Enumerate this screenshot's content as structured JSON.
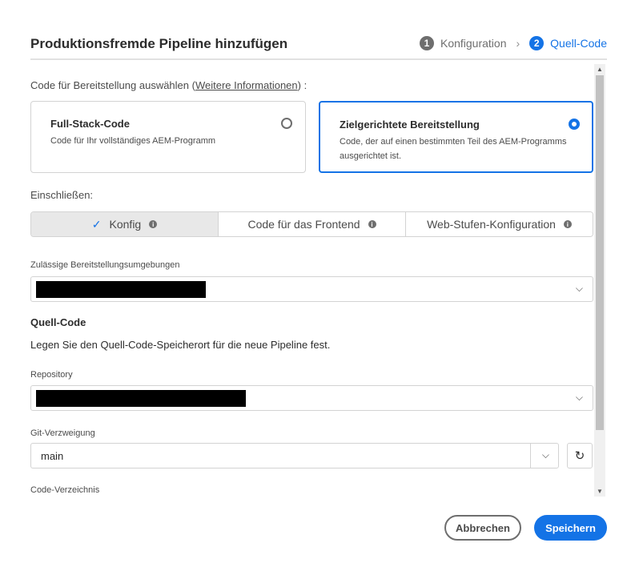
{
  "dialog": {
    "title": "Produktionsfremde Pipeline hinzufügen"
  },
  "steps": [
    {
      "number": "1",
      "label": "Konfiguration"
    },
    {
      "number": "2",
      "label": "Quell-Code"
    }
  ],
  "deployment": {
    "prompt": "Code für Bereitstellung auswählen",
    "link_open": "(",
    "link_text": "Weitere Informationen",
    "link_close": ") :",
    "options": [
      {
        "title": "Full-Stack-Code",
        "description": "Code für Ihr vollständiges AEM-Programm",
        "selected": false
      },
      {
        "title": "Zielgerichtete Bereitstellung",
        "description": "Code, der auf einen bestimmten Teil des AEM-Programms ausgerichtet ist.",
        "selected": true
      }
    ]
  },
  "include": {
    "label": "Einschließen:",
    "options": [
      {
        "label": "Konfig",
        "active": true
      },
      {
        "label": "Code für das Frontend",
        "active": false
      },
      {
        "label": "Web-Stufen-Konfiguration",
        "active": false
      }
    ]
  },
  "environments": {
    "label": "Zulässige Bereitstellungsumgebungen",
    "value": ""
  },
  "source": {
    "title": "Quell-Code",
    "description": "Legen Sie den Quell-Code-Speicherort für die neue Pipeline fest."
  },
  "repository": {
    "label": "Repository",
    "value": ""
  },
  "git_branch": {
    "label": "Git-Verzweigung",
    "value": "main"
  },
  "code_directory": {
    "label": "Code-Verzeichnis"
  },
  "footer": {
    "cancel_label": "Abbrechen",
    "save_label": "Speichern"
  },
  "colors": {
    "accent": "#1473e6",
    "step_inactive": "#6e6e6e"
  },
  "icons": {
    "check": "check-icon",
    "info": "info-icon",
    "chevron": "chevron-down-icon",
    "refresh": "refresh-icon"
  }
}
